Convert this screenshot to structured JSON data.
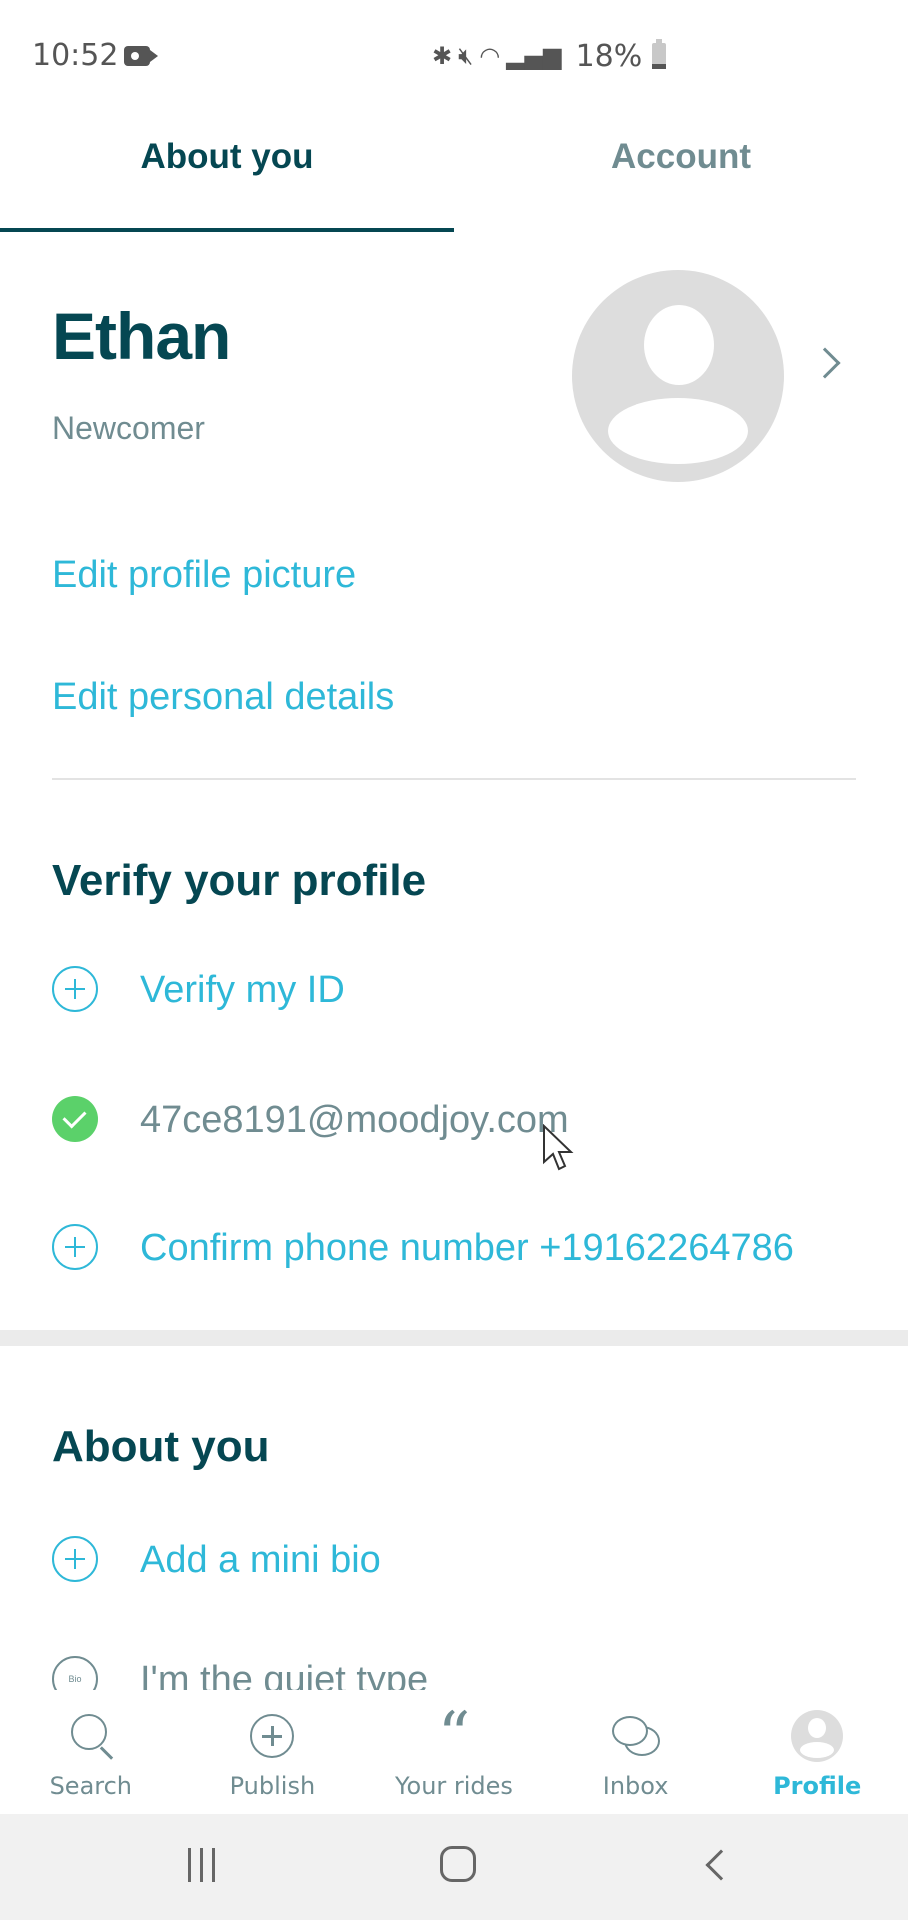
{
  "status_bar": {
    "time": "10:52",
    "icons": [
      "screen-record-icon",
      "bluetooth-icon",
      "mute-icon",
      "wifi-icon",
      "signal-icon",
      "battery-icon"
    ],
    "battery_percent": "18%",
    "battery_level": 0.18
  },
  "tabs": [
    {
      "label": "About you",
      "active": true
    },
    {
      "label": "Account",
      "active": false
    }
  ],
  "profile": {
    "name": "Ethan",
    "level": "Newcomer",
    "edit_picture_label": "Edit profile picture",
    "edit_details_label": "Edit personal details"
  },
  "verify_section": {
    "title": "Verify your profile",
    "items": [
      {
        "label": "Verify my ID",
        "status": "pending",
        "icon": "plus-circle-icon"
      },
      {
        "label": "47ce8191@moodjoy.com",
        "status": "verified",
        "icon": "check-circle-icon"
      },
      {
        "label": "Confirm phone number +19162264786",
        "status": "pending",
        "icon": "plus-circle-icon"
      }
    ]
  },
  "about_section": {
    "title": "About you",
    "items": [
      {
        "label": "Add a mini bio",
        "icon": "plus-circle-icon"
      },
      {
        "label": "I'm the quiet type",
        "icon": "bio-icon",
        "icon_text": "Bio"
      }
    ]
  },
  "bottom_nav": [
    {
      "label": "Search",
      "icon": "search-icon",
      "active": false
    },
    {
      "label": "Publish",
      "icon": "plus-circle-icon",
      "active": false
    },
    {
      "label": "Your rides",
      "icon": "quote-icon",
      "active": false
    },
    {
      "label": "Inbox",
      "icon": "chat-bubbles-icon",
      "active": false
    },
    {
      "label": "Profile",
      "icon": "profile-avatar-icon",
      "active": true
    }
  ],
  "colors": {
    "primary_dark": "#054752",
    "accent": "#2eb8d8",
    "muted": "#708c91",
    "verified_green": "#5bd16a",
    "avatar_gray": "#dddddd"
  }
}
